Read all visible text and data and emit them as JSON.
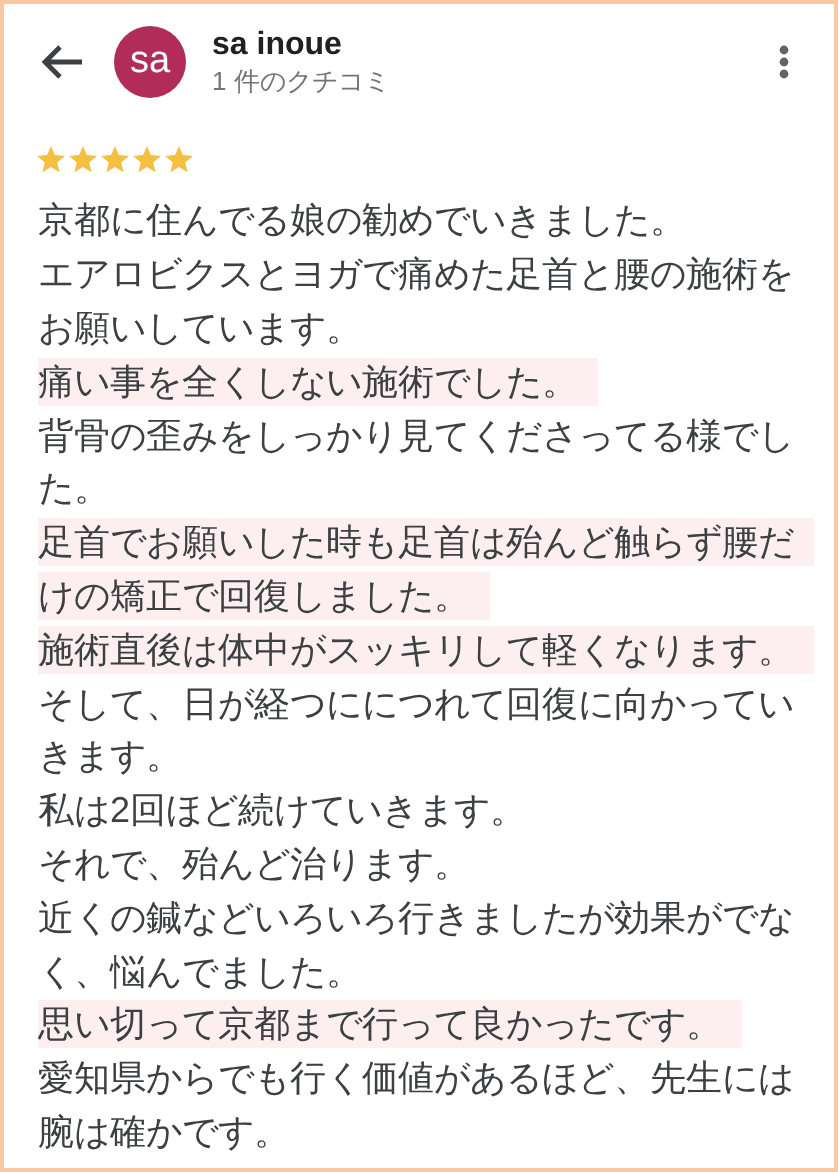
{
  "reviewer": {
    "avatar_initials": "sa",
    "name": "sa inoue",
    "review_count": "1 件のクチコミ"
  },
  "review": {
    "stars": 5,
    "lines": [
      {
        "text": "京都に住んでる娘の勧めでいきました。",
        "highlighted": false
      },
      {
        "text": "エアロビクスとヨガで痛めた足首と腰の施術を",
        "highlighted": false
      },
      {
        "text": "お願いしています。",
        "highlighted": false
      },
      {
        "text": "痛い事を全くしない施術でした。",
        "highlighted": true
      },
      {
        "text": "背骨の歪みをしっかり見てくださってる様でし",
        "highlighted": false
      },
      {
        "text": "た。",
        "highlighted": false
      },
      {
        "text": "足首でお願いした時も足首は殆んど触らず腰だ",
        "highlighted": true
      },
      {
        "text": "けの矯正で回復しました。",
        "highlighted": true
      },
      {
        "text": "施術直後は体中がスッキリして軽くなります。",
        "highlighted": true
      },
      {
        "text": "そして、日が経つににつれて回復に向かってい",
        "highlighted": false
      },
      {
        "text": "きます。",
        "highlighted": false
      },
      {
        "text": "私は2回ほど続けていきます。",
        "highlighted": false
      },
      {
        "text": "それで、殆んど治ります。",
        "highlighted": false
      },
      {
        "text": "近くの鍼などいろいろ行きましたが効果がでな",
        "highlighted": false
      },
      {
        "text": "く、悩んでました。",
        "highlighted": false
      },
      {
        "text": "思い切って京都まで行って良かったです。",
        "highlighted": true
      },
      {
        "text": "愛知県からでも行く価値があるほど、先生には",
        "highlighted": false
      },
      {
        "text": "腕は確かです。",
        "highlighted": false
      }
    ]
  }
}
